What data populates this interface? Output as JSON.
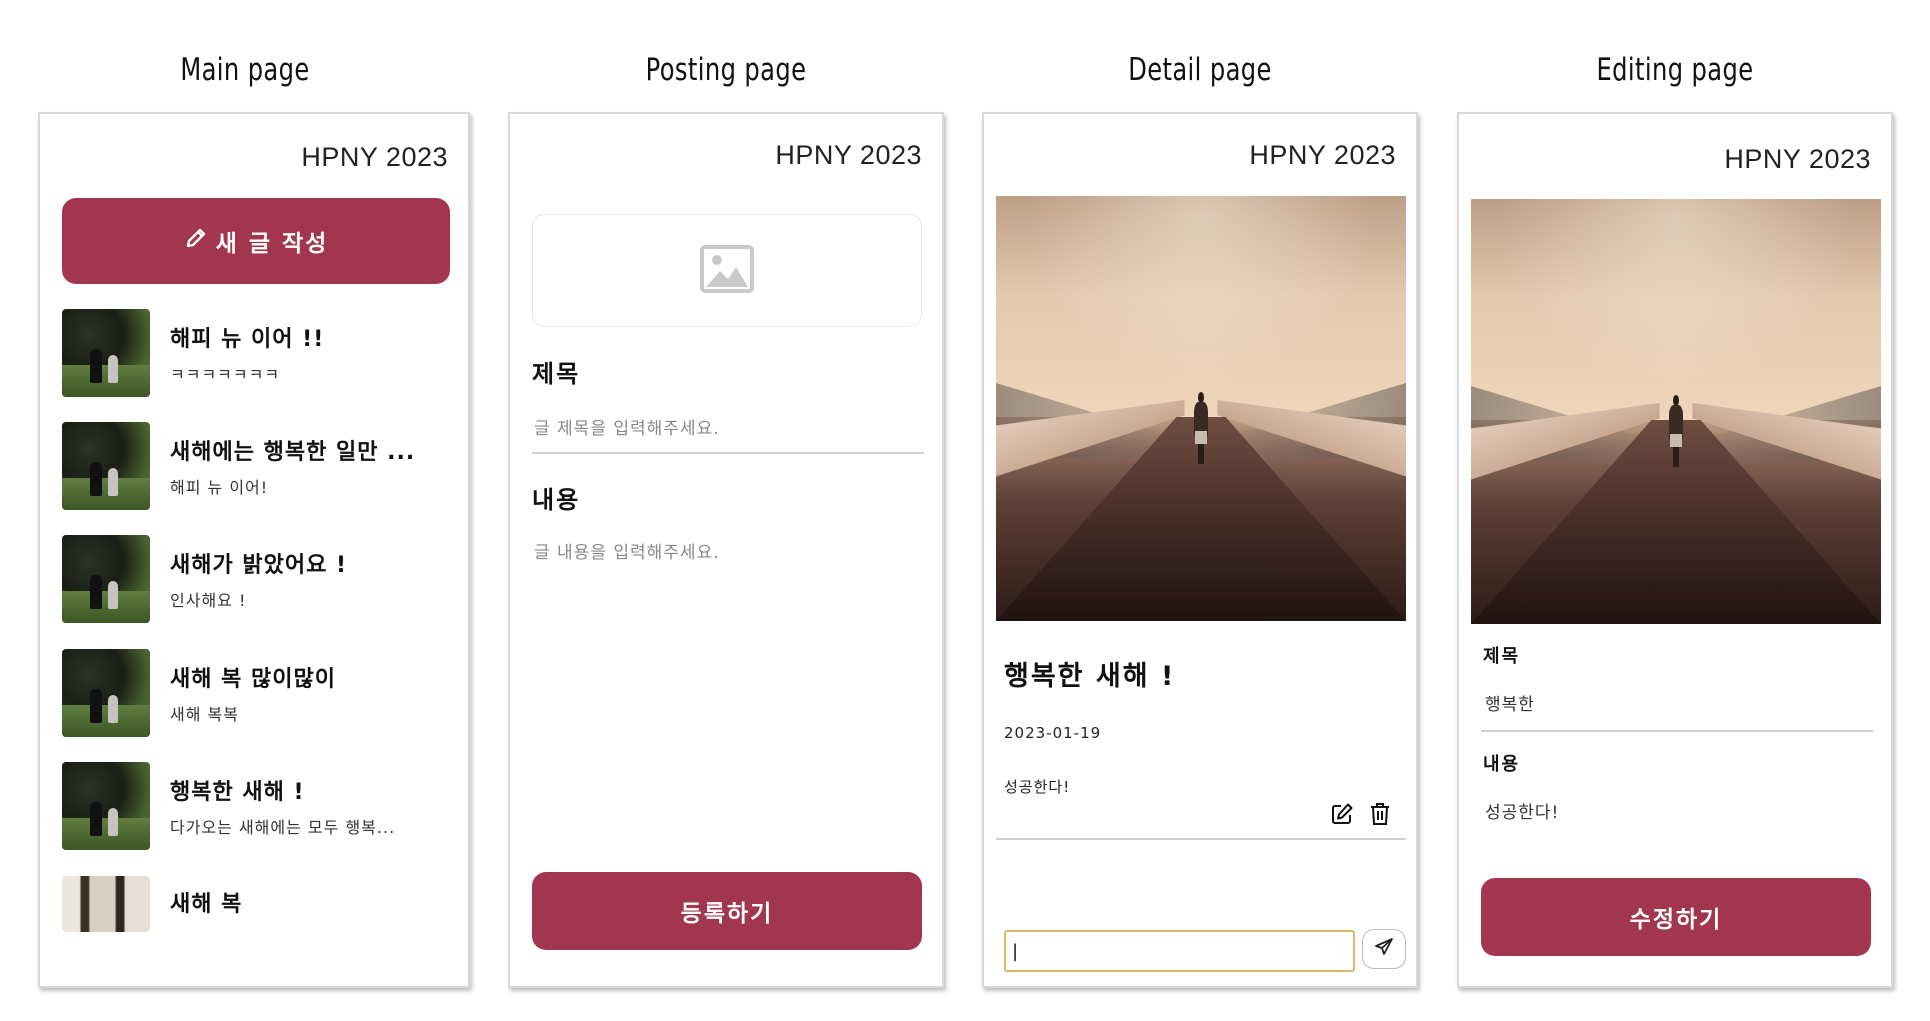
{
  "labels": {
    "main": "Main page",
    "posting": "Posting page",
    "detail": "Detail page",
    "editing": "Editing page"
  },
  "brand": "HPNY 2023",
  "colors": {
    "accent": "#a3364f",
    "input_focus": "#dcb76a"
  },
  "main": {
    "new_post_button": "새 글 작성",
    "new_post_icon": "pencil-icon",
    "posts": [
      {
        "title": "해피 뉴 이어 !!",
        "content": "ㅋㅋㅋㅋㅋㅋㅋ"
      },
      {
        "title": "새해에는 행복한 일만 ...",
        "content": "해피 뉴 이어!"
      },
      {
        "title": "새해가 밝았어요 !",
        "content": "인사해요 !"
      },
      {
        "title": "새해 복 많이많이",
        "content": "새해 복복"
      },
      {
        "title": "행복한 새해 !",
        "content": "다가오는 새해에는 모두 행복..."
      },
      {
        "title": "새해 복",
        "content": ""
      }
    ]
  },
  "posting": {
    "image_icon": "image-placeholder-icon",
    "title_label": "제목",
    "title_placeholder": "글 제목을 입력해주세요.",
    "content_label": "내용",
    "content_placeholder": "글 내용을 입력해주세요.",
    "submit_button": "등록하기"
  },
  "detail": {
    "title": "행복한 새해 !",
    "date": "2023-01-19",
    "content": "성공한다!",
    "edit_icon": "edit-icon",
    "delete_icon": "trash-icon",
    "comment_value": "|",
    "send_icon": "send-icon"
  },
  "editing": {
    "title_label": "제목",
    "title_value": "행복한",
    "content_label": "내용",
    "content_value": "성공한다!",
    "submit_button": "수정하기"
  }
}
